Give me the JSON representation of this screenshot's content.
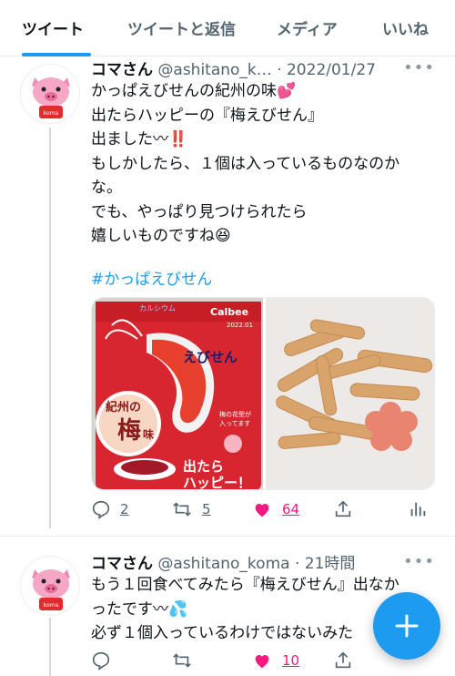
{
  "tabs": [
    {
      "label": "ツイート",
      "active": true
    },
    {
      "label": "ツイートと返信",
      "active": false
    },
    {
      "label": "メディア",
      "active": false
    },
    {
      "label": "いいね",
      "active": false
    }
  ],
  "tweets": [
    {
      "name": "コマさん",
      "handle": "@ashitano_k…",
      "time": "· 2022/01/27",
      "lines": [
        "かっぱえびせんの紀州の味💕",
        "出たらハッピーの『梅えびせん』",
        "出ました〰‼️",
        "もしかしたら、１個は入っているものなのかな。",
        "でも、やっぱり見つけられたら",
        "嬉しいものですね😆"
      ],
      "line3_end": "な。",
      "hashtag": "#かっぱえびせん",
      "replies": "2",
      "retweets": "5",
      "likes": "64"
    },
    {
      "name": "コマさん",
      "handle": "@ashitano_koma",
      "time": "· 21時間",
      "lines": [
        "もう１回食べてみたら『梅えびせん』出なか",
        "ったです〰💦",
        "必ず１個入っているわけではないみた"
      ],
      "likes": "10"
    }
  ],
  "media": {
    "bag_brand": "Calbee",
    "bag_title": "かっぱえびせん",
    "bag_flavor_1": "紀州の",
    "bag_flavor_2": "梅",
    "bag_flavor_3": "味",
    "bag_note": "梅の花型が入ってます",
    "bag_happy": "出たら ハッピー！",
    "bag_date": "2022.01",
    "avatar_label": "koma"
  },
  "colors": {
    "accent": "#1d9bf0",
    "like": "#f91880",
    "muted": "#536471",
    "bag_red": "#d7262f"
  }
}
